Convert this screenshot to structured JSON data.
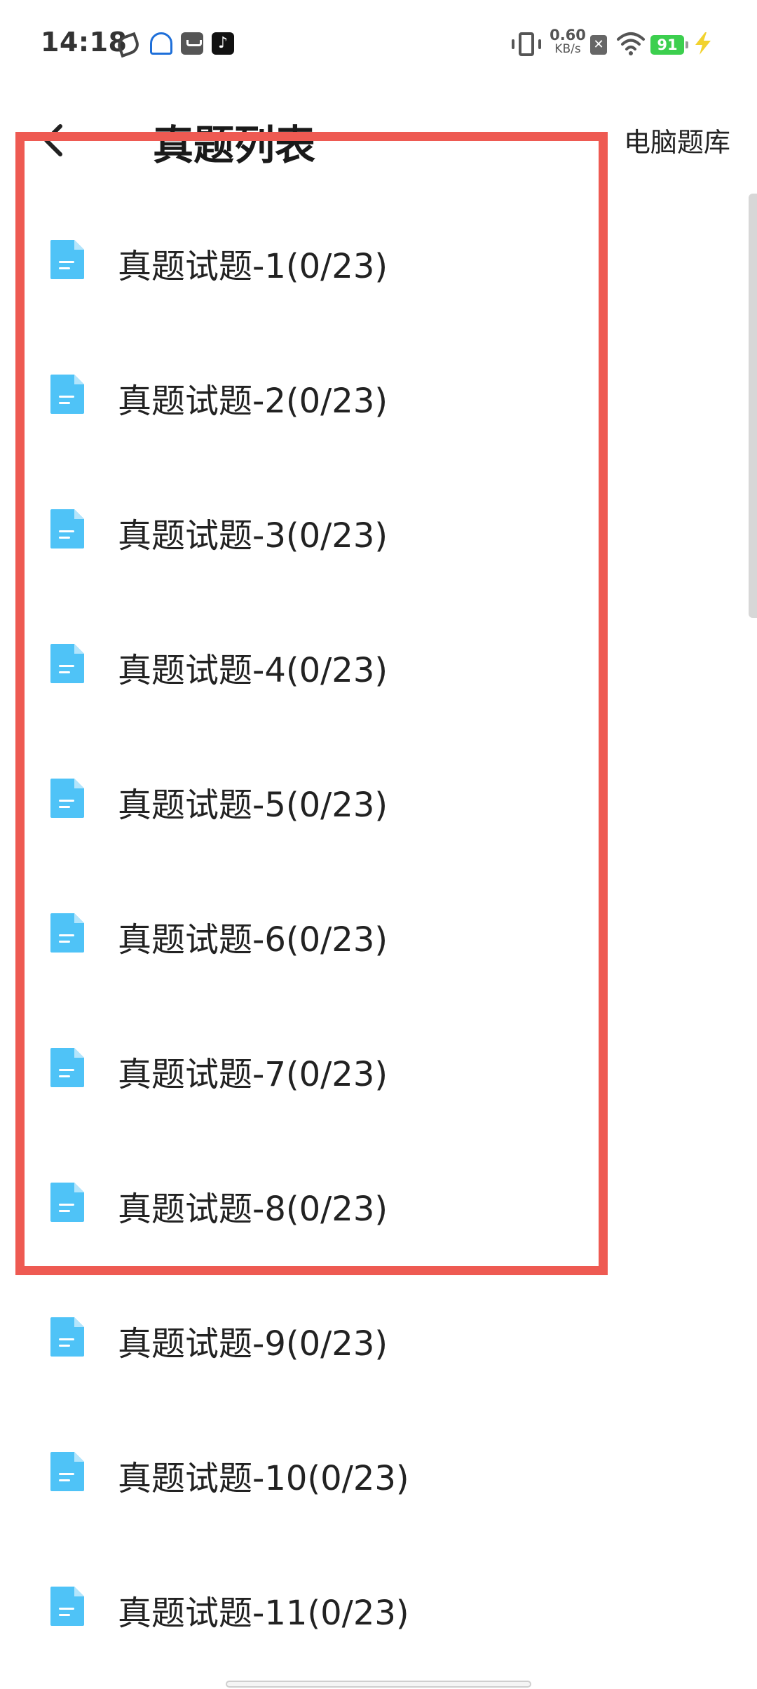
{
  "status_bar": {
    "time": "14:18",
    "net_speed_value": "0.60",
    "net_speed_unit": "KB/s",
    "battery_level": "91",
    "x_badge": "✕"
  },
  "header": {
    "title": "真题列表",
    "right_link": "电脑题库"
  },
  "exam_list": {
    "items": [
      "真题试题-1(0/23)",
      "真题试题-2(0/23)",
      "真题试题-3(0/23)",
      "真题试题-4(0/23)",
      "真题试题-5(0/23)",
      "真题试题-6(0/23)",
      "真题试题-7(0/23)",
      "真题试题-8(0/23)",
      "真题试题-9(0/23)",
      "真题试题-10(0/23)",
      "真题试题-11(0/23)"
    ]
  },
  "colors": {
    "doc_icon": "#4fc3f7",
    "highlight": "#ee5a52",
    "battery": "#3ccf4e"
  }
}
